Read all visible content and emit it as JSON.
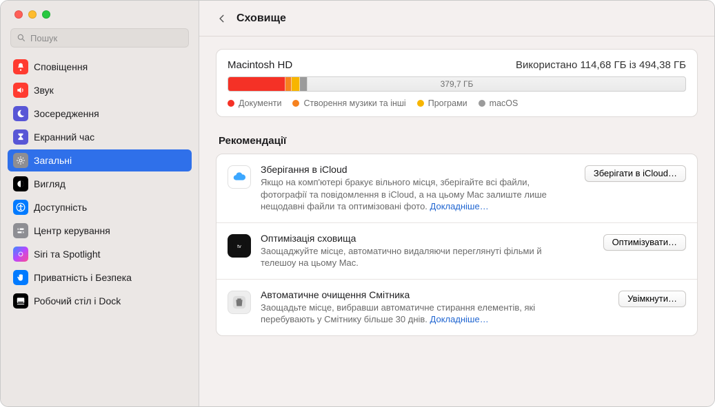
{
  "search": {
    "placeholder": "Пошук"
  },
  "sidebar": {
    "items": [
      {
        "label": "Сповіщення",
        "icon": "bell-icon",
        "bg": "#ff3b30"
      },
      {
        "label": "Звук",
        "icon": "speaker-icon",
        "bg": "#ff3b30"
      },
      {
        "label": "Зосередження",
        "icon": "moon-icon",
        "bg": "#5856d6"
      },
      {
        "label": "Екранний час",
        "icon": "hourglass-icon",
        "bg": "#5856d6"
      },
      {
        "label": "Загальні",
        "icon": "gear-icon",
        "bg": "#8e8e93",
        "selected": true
      },
      {
        "label": "Вигляд",
        "icon": "contrast-icon",
        "bg": "#000000"
      },
      {
        "label": "Доступність",
        "icon": "accessibility-icon",
        "bg": "#007aff"
      },
      {
        "label": "Центр керування",
        "icon": "switches-icon",
        "bg": "#8e8e93"
      },
      {
        "label": "Siri та Spotlight",
        "icon": "siri-icon",
        "bg": "linear"
      },
      {
        "label": "Приватність і Безпека",
        "icon": "hand-icon",
        "bg": "#007aff"
      },
      {
        "label": "Робочий стіл і Dock",
        "icon": "dock-icon",
        "bg": "#000000"
      }
    ]
  },
  "page": {
    "title": "Сховище"
  },
  "disk": {
    "name": "Macintosh HD",
    "usage_text": "Використано 114,68 ГБ із 494,38 ГБ",
    "free_text": "379,7 ГБ",
    "segments": [
      {
        "name": "documents",
        "color": "#f53126",
        "pct": 12.5
      },
      {
        "name": "music",
        "color": "#f6821f",
        "pct": 1.4
      },
      {
        "name": "apps",
        "color": "#f7b500",
        "pct": 1.8
      },
      {
        "name": "macos",
        "color": "#9b9b9b",
        "pct": 1.6
      }
    ],
    "legend": [
      {
        "label": "Документи",
        "color": "#f53126"
      },
      {
        "label": "Створення музики та інші",
        "color": "#f6821f"
      },
      {
        "label": "Програми",
        "color": "#f7b500"
      },
      {
        "label": "macOS",
        "color": "#9b9b9b"
      }
    ]
  },
  "recommendations": {
    "heading": "Рекомендації",
    "items": [
      {
        "icon": "icloud-icon",
        "title": "Зберігання в iCloud",
        "desc": "Якщо на комп'ютері бракує вільного місця, зберігайте всі файли, фотографії та повідомлення в iCloud, а на цьому Mac залиште лише нещодавні файли та оптимізовані фото.",
        "more": "Докладніше…",
        "button": "Зберігати в iCloud…"
      },
      {
        "icon": "appletv-icon",
        "title": "Оптимізація сховища",
        "desc": "Заощаджуйте місце, автоматично видаляючи переглянуті фільми й телешоу на цьому Mac.",
        "more": "",
        "button": "Оптимізувати…"
      },
      {
        "icon": "trash-icon",
        "title": "Автоматичне очищення Смітника",
        "desc": "Заощадьте місце, вибравши автоматичне стирання елементів, які перебувають у Смітнику більше 30 днів.",
        "more": "Докладніше…",
        "button": "Увімкнути…"
      }
    ]
  }
}
